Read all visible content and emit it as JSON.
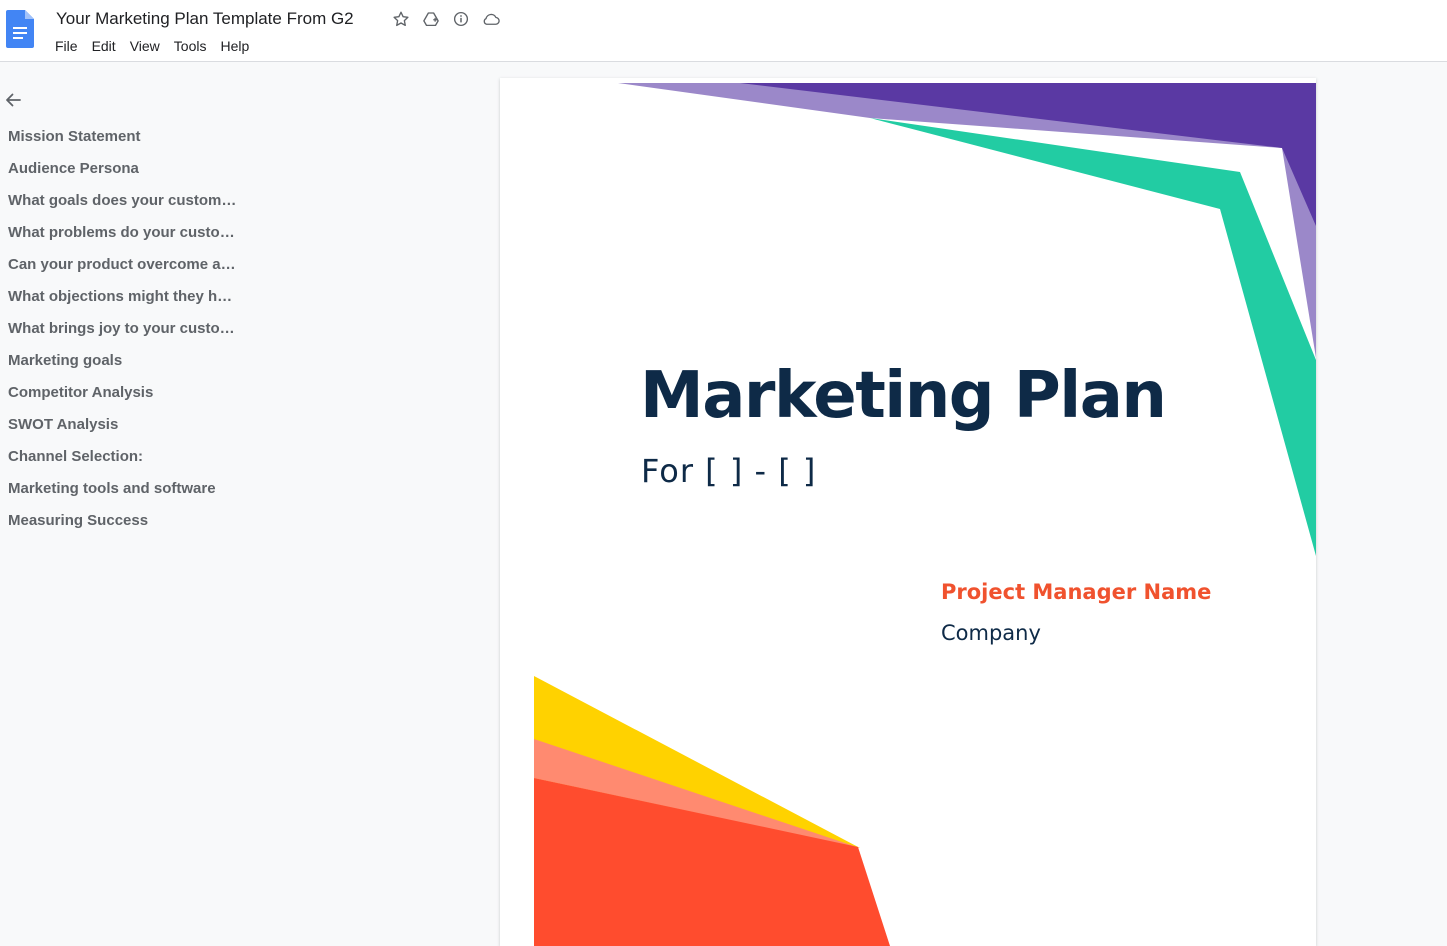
{
  "app": {
    "doc_title": "Your Marketing Plan Template From G2",
    "icons": [
      "star-icon",
      "move-to-drive-icon",
      "info-icon",
      "cloud-status-icon"
    ],
    "menu": [
      "File",
      "Edit",
      "View",
      "Tools",
      "Help"
    ]
  },
  "outline": {
    "items": [
      "Mission Statement",
      "Audience Persona",
      "What goals does your customer have?",
      "What problems do your customers face?",
      "Can your product overcome any of these problems?",
      "What objections might they have?",
      "What brings joy to your customers?",
      "Marketing goals",
      "Competitor Analysis",
      "SWOT Analysis",
      "Channel Selection:",
      "Marketing tools and software",
      "Measuring Success"
    ]
  },
  "document": {
    "title": "Marketing Plan",
    "subtitle": "For [ ] - [ ]",
    "project_manager": "Project Manager Name",
    "company": "Company"
  },
  "colors": {
    "doc_blue": "#4285f4",
    "title_navy": "#0e2a47",
    "accent_orange": "#f0522e",
    "purple_dark": "#5a39a3",
    "purple_light": "#9b88c9",
    "teal": "#22cca3",
    "yellow": "#ffd200",
    "salmon": "#ff8a70",
    "red_orange": "#ff4c2e"
  }
}
